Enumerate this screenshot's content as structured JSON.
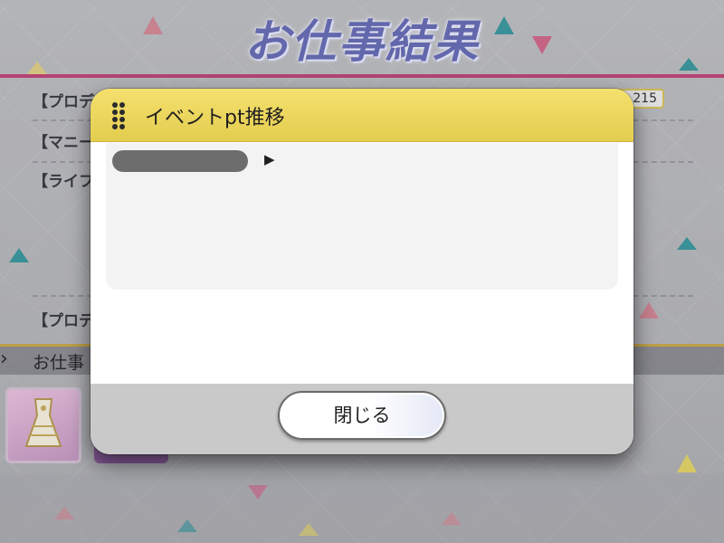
{
  "background": {
    "title": "お仕事結果",
    "rows": [
      {
        "label": "【プロデ"
      },
      {
        "label": "【マニー"
      },
      {
        "label": "【ライフ"
      },
      {
        "label": "【プロデ"
      }
    ],
    "value_box": "215",
    "section_label": "お仕事",
    "colors": {
      "top_line": "#c0487a",
      "title": "#6a6fb8"
    }
  },
  "dialog": {
    "title": "イベントpt推移",
    "drag_handle_icon": "drag-handle-icon",
    "expand_icon": "play-triangle-icon",
    "close_label": "閉じる",
    "colors": {
      "header": "#e8d35a",
      "footer": "#c9c9c9",
      "panel": "#f3f3f3"
    }
  }
}
